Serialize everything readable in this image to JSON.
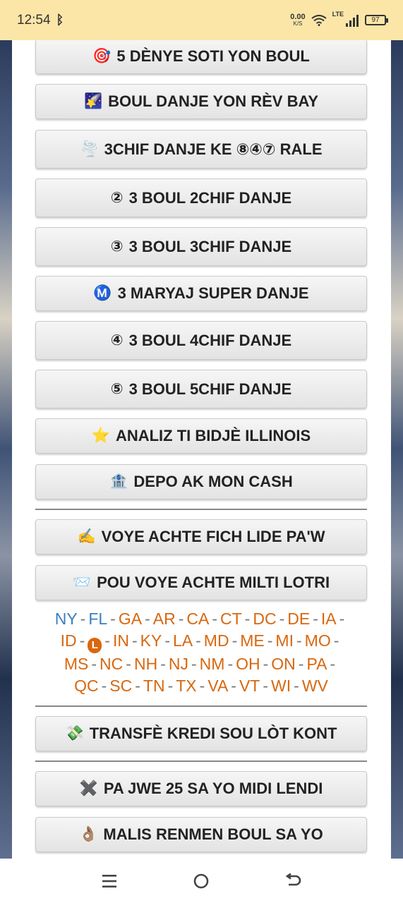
{
  "status": {
    "time": "12:54",
    "net_speed": "0.00",
    "net_unit": "K/S",
    "lte": "LTE",
    "battery": "97"
  },
  "buttons": [
    {
      "icon": "🎯",
      "label": "5 DÈNYE SOTI YON BOUL"
    },
    {
      "icon": "🌠",
      "label": "BOUL DANJE YON RÈV BAY"
    },
    {
      "icon": "🌪️",
      "label": "3CHIF DANJE KE ⑧④⑦ RALE"
    },
    {
      "icon": "②",
      "label": "3 BOUL 2CHIF DANJE"
    },
    {
      "icon": "③",
      "label": "3 BOUL 3CHIF DANJE"
    },
    {
      "icon": "Ⓜ️",
      "label": "3 MARYAJ SUPER DANJE"
    },
    {
      "icon": "④",
      "label": "3 BOUL 4CHIF DANJE"
    },
    {
      "icon": "⑤",
      "label": "3 BOUL 5CHIF DANJE"
    },
    {
      "icon": "⭐",
      "label": "ANALIZ TI BIDJÈ ILLINOIS"
    },
    {
      "icon": "🏦",
      "label": "DEPO AK MON CASH"
    },
    {
      "icon": "✍️",
      "label": "VOYE ACHTE FICH LIDE PA'W"
    },
    {
      "icon": "📨",
      "label": "POU VOYE ACHTE MILTI LOTRI"
    },
    {
      "icon": "💸",
      "label": "TRANSFÈ KREDI SOU LÒT KONT"
    },
    {
      "icon": "✖️",
      "label": "PA JWE 25 SA YO MIDI LENDI"
    },
    {
      "icon": "👌🏽",
      "label": "MALIS RENMEN BOUL SA YO"
    }
  ],
  "states": {
    "separator": "-",
    "l_badge": "L",
    "line1": [
      "NY",
      "FL",
      "GA",
      "AR",
      "CA",
      "CT",
      "DC",
      "DE",
      "IA"
    ],
    "line2": [
      "ID",
      "IN",
      "KY",
      "LA",
      "MD",
      "ME",
      "MI",
      "MO"
    ],
    "line3": [
      "MS",
      "NC",
      "NH",
      "NJ",
      "NM",
      "OH",
      "ON",
      "PA"
    ],
    "line4": [
      "QC",
      "SC",
      "TN",
      "TX",
      "VA",
      "VT",
      "WI",
      "WV"
    ]
  },
  "colors": {
    "status_bg": "#fbe6a8",
    "state_orange": "#d8670e",
    "state_blue": "#3a7fc1"
  }
}
